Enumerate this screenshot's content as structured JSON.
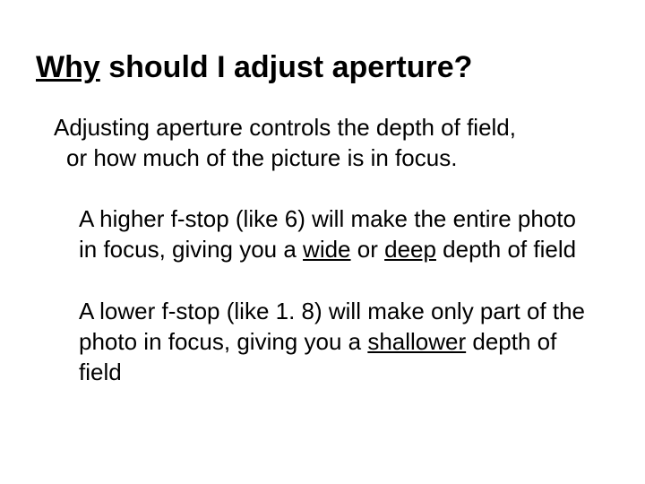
{
  "title": {
    "underlined": "Why",
    "rest": " should I adjust aperture?"
  },
  "intro": {
    "line1": "Adjusting aperture controls the depth of field,",
    "line2": "or how much of the picture is in focus."
  },
  "high": {
    "pre": "A higher f-stop (like 6) will make the entire photo in focus, giving you a ",
    "u1": "wide",
    "mid": " or ",
    "u2": "deep",
    "post": " depth of field"
  },
  "low": {
    "pre": "A lower f-stop (like 1. 8) will make only part of the photo in focus, giving you a ",
    "u1": "shallower",
    "post": " depth of field"
  }
}
